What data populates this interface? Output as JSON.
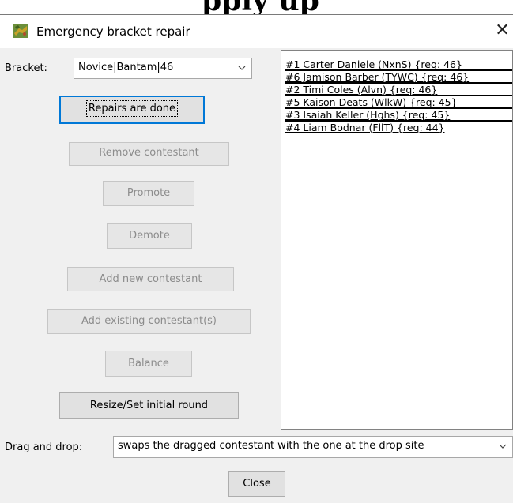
{
  "background_text": "pply up",
  "window": {
    "title": "Emergency bracket repair",
    "close_glyph": "✕"
  },
  "bracket": {
    "label": "Bracket:",
    "value": "Novice|Bantam|46"
  },
  "buttons": {
    "repairs_done": "Repairs are done",
    "remove_contestant": "Remove contestant",
    "promote": "Promote",
    "demote": "Demote",
    "add_new_contestant": "Add new contestant",
    "add_existing_contestants": "Add existing contestant(s)",
    "balance": "Balance",
    "resize_set_initial_round": "Resize/Set initial round",
    "close": "Close"
  },
  "contestants": [
    "#1 Carter Daniele (NxnS) {req: 46}",
    "#6 Jamison Barber (TYWC) {req: 46}",
    "#2 Timi Coles (Alvn) {req: 46}",
    "#5 Kaison Deats (WlkW) {req: 45}",
    "#3 Isaiah Keller (Hghs) {req: 45}",
    "#4 Liam Bodnar (FllT) {req: 44}"
  ],
  "drag_and_drop": {
    "label": "Drag and drop:",
    "value": "swaps the dragged contestant with the one at the drop site"
  },
  "icons": {
    "app": "lizard-app-icon",
    "dropdown": "chevron-down-icon",
    "close": "close-icon"
  }
}
